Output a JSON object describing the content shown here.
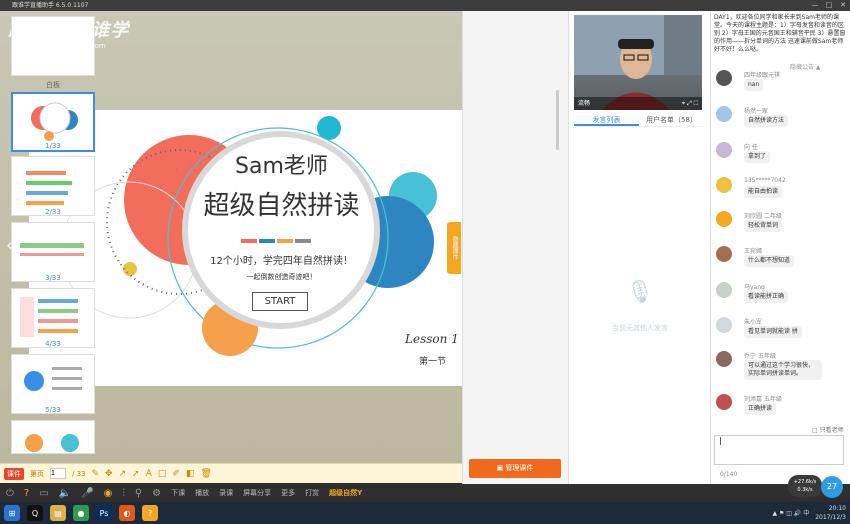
{
  "window": {
    "title": "跟谁学直播助手 6.5.0.1107",
    "controls": [
      "—",
      "□",
      "✕"
    ]
  },
  "logo": {
    "text": "跟谁学 跟谁学",
    "url": "genshuixue.com"
  },
  "slide": {
    "teacher": "Sam老师",
    "title": "超级自然拼读",
    "subtitle": "12个小时，学完四年自然拼读！",
    "tagline": "一起倒数创造奇迹吧！",
    "start_label": "START",
    "lesson": "Lesson 1",
    "section": "第一节",
    "collapse_tab": "隐藏课件",
    "colors": {
      "red": "#f26d5b",
      "blue": "#2e86c1",
      "teal": "#48c0d6",
      "orange": "#f5a04a",
      "yellow": "#e9c442",
      "cyan": "#1fb7d4"
    }
  },
  "draw_toolbar": {
    "tag": "课件",
    "label": "第页",
    "page_value": "1",
    "page_total": "/ 33",
    "icons": [
      "pen-icon",
      "move-icon",
      "arrow-icon",
      "pointer-icon",
      "text-icon",
      "rect-icon",
      "brush-icon",
      "eraser-icon",
      "delete-icon"
    ]
  },
  "main_toolbar": {
    "items": [
      "下课",
      "播放",
      "录课",
      "屏幕分享",
      "更多",
      "打赏"
    ],
    "brand": "超级自然Y"
  },
  "thumbnails": {
    "items": [
      {
        "label": "白板"
      },
      {
        "label": "1/33"
      },
      {
        "label": "2/33"
      },
      {
        "label": "3/33"
      },
      {
        "label": "4/33"
      },
      {
        "label": "5/33"
      }
    ],
    "active_index": 1,
    "manage_label": "管理课件"
  },
  "video": {
    "name": "流畅"
  },
  "user_tabs": {
    "speak_list": "发言列表",
    "user_list": "用户名单（58）"
  },
  "mic_note": "当前无其他人发言",
  "announcement": {
    "text": "DAY1，欢迎各位同学和家长来到Sam老师的课堂。今天的课程主题是：1）字母发音和读音的区别 2）字母王国的元音国王和辅音平民 3）悬置窗的作用——拆分单词的方法 迅速课前做Sam老师好不好！么么哒。",
    "link": "隐藏公告 ▲"
  },
  "messages": [
    {
      "name": "四年级跟元祺",
      "text": "nan",
      "avatar_color": "#555"
    },
    {
      "name": "杨然一家",
      "text": "自然拼读方法",
      "avatar_color": "#a3c6e8"
    },
    {
      "name": "向 任",
      "text": "拿到了",
      "avatar_color": "#c8b8d8"
    },
    {
      "name": "135*****7042",
      "text": "能自由拍读",
      "avatar_color": "#f0c040"
    },
    {
      "name": "刘欣圆 二年级",
      "text": "轻松背单词",
      "avatar_color": "#f5a623"
    },
    {
      "name": "王宛嫣",
      "text": "什么都不想知道",
      "avatar_color": "#a07050"
    },
    {
      "name": "马yang",
      "text": "看读能拼正确",
      "avatar_color": "#c8d0c8"
    },
    {
      "name": "朱小军",
      "text": "看见单词就能读 拼",
      "avatar_color": "#d0d8e0"
    },
    {
      "name": "乔宁 五年级",
      "text": "可以通过这个学习很快，实际单词拼读单词。",
      "avatar_color": "#8a6a5a"
    },
    {
      "name": "刘添嘉 五年级",
      "text": "正确拼读",
      "avatar_color": "#c05050"
    }
  ],
  "only_teacher": "□ 只看老师",
  "chat_input": {
    "value": "|",
    "count": "0/140"
  },
  "net": {
    "up": "+27.6k/s",
    "down": "0.3k/s",
    "number": "27"
  },
  "tray": {
    "time": "20:10",
    "date": "2017/12/3"
  }
}
